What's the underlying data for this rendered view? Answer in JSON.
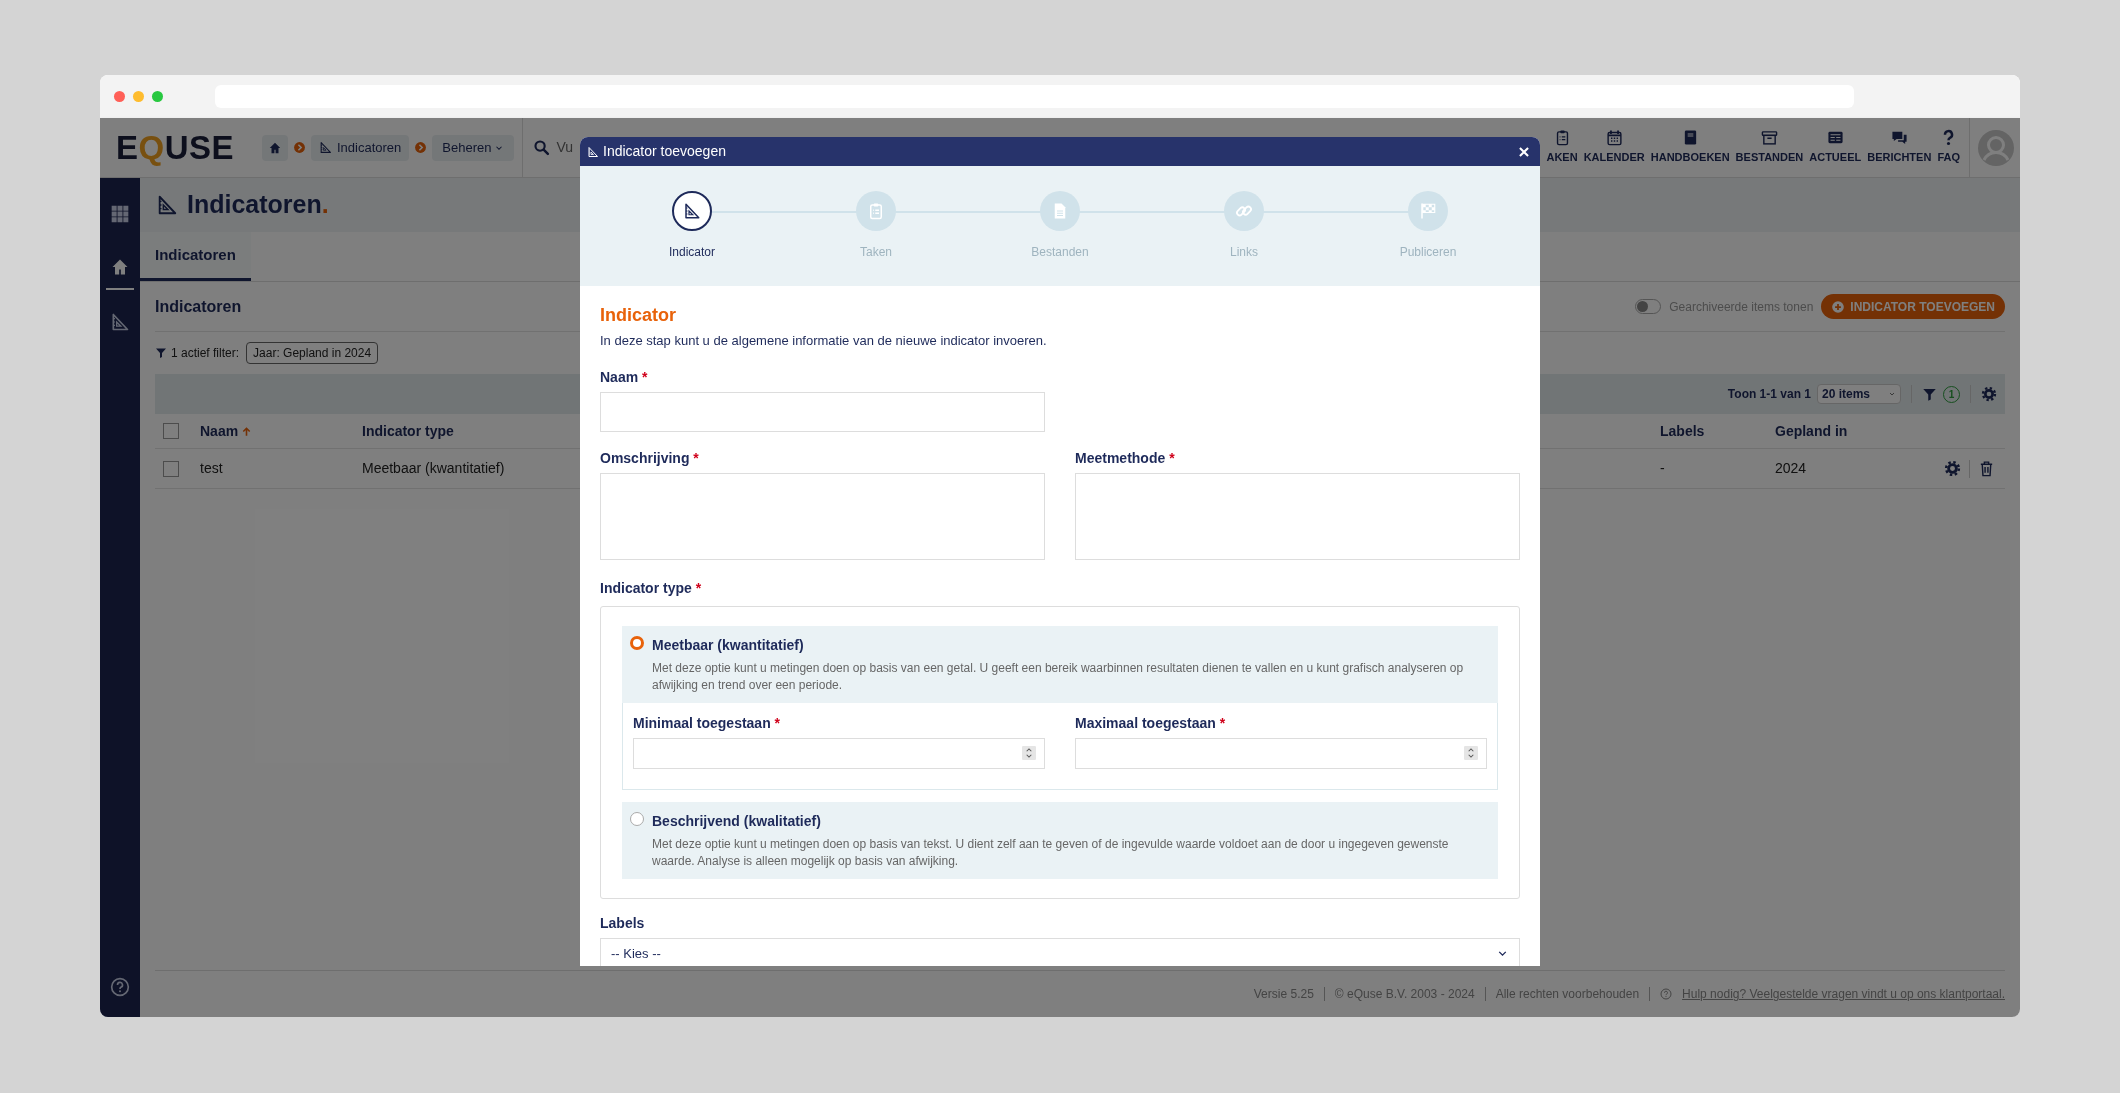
{
  "header": {
    "logo_parts": [
      {
        "text": "E",
        "accent": false
      },
      {
        "text": "Q",
        "accent": true
      },
      {
        "text": "USE",
        "accent": false
      }
    ],
    "breadcrumbs": [
      {
        "kind": "home"
      },
      {
        "kind": "page",
        "label": "Indicatoren"
      },
      {
        "kind": "menu",
        "label": "Beheren"
      }
    ],
    "search": {
      "placeholder": "Vu"
    },
    "nav": [
      {
        "label": "AKEN"
      },
      {
        "label": "KALENDER"
      },
      {
        "label": "HANDBOEKEN"
      },
      {
        "label": "BESTANDEN"
      },
      {
        "label": "ACTUEEL"
      },
      {
        "label": "BERICHTEN"
      },
      {
        "label": "FAQ"
      }
    ]
  },
  "sidebar": {
    "items": [
      {
        "selected": false
      },
      {
        "selected": true
      },
      {
        "selected": false
      }
    ]
  },
  "page": {
    "title": "Indicatoren",
    "title_mark": ".",
    "tabs": [
      {
        "label": "Indicatoren",
        "selected": true
      }
    ],
    "panel": {
      "heading": "Indicatoren",
      "archive_toggle": {
        "label": "Gearchiveerde items tonen",
        "on": false
      },
      "add_button": "INDICATOR TOEVOEGEN",
      "filter": {
        "label": "1 actief filter:",
        "chips": [
          "Jaar: Gepland in 2024"
        ]
      },
      "toolbar": {
        "range": "Toon 1-1 van 1",
        "page_size": "20 items",
        "filter_count": "1"
      },
      "table": {
        "all_checked": false,
        "columns": [
          {
            "label": "Naam",
            "sorted": true
          },
          {
            "label": "Indicator type",
            "sorted": false
          },
          {
            "label": "Labels",
            "sorted": false
          },
          {
            "label": "Gepland in",
            "sorted": false
          }
        ],
        "rows": [
          {
            "checked": false,
            "cells": [
              "test",
              "Meetbaar (kwantitatief)",
              "-",
              "2024"
            ]
          }
        ]
      }
    }
  },
  "footer": {
    "items": [
      "Versie 5.25",
      "© eQuse B.V. 2003 - 2024",
      "Alle rechten voorbehouden"
    ],
    "help_link": "Hulp nodig? Veelgestelde vragen vindt u op ons klantportaal."
  },
  "modal": {
    "title": "Indicator toevoegen",
    "steps": [
      {
        "label": "Indicator",
        "selected": true
      },
      {
        "label": "Taken",
        "selected": false
      },
      {
        "label": "Bestanden",
        "selected": false
      },
      {
        "label": "Links",
        "selected": false
      },
      {
        "label": "Publiceren",
        "selected": false
      }
    ],
    "section_title": "Indicator",
    "intro": "In deze stap kunt u de algemene informatie van de nieuwe indicator invoeren.",
    "name_field": {
      "label": "Naam",
      "required_mark": "*"
    },
    "text_fields": [
      {
        "label": "Omschrijving",
        "required_mark": "*"
      },
      {
        "label": "Meetmethode",
        "required_mark": "*"
      }
    ],
    "type_label": {
      "label": "Indicator type",
      "required_mark": "*"
    },
    "options": [
      {
        "title": "Meetbaar (kwantitatief)",
        "description": "Met deze optie kunt u metingen doen op basis van een getal. U geeft een bereik waarbinnen resultaten dienen te vallen en u kunt grafisch analyseren op afwijking en trend over een periode.",
        "selected": true,
        "fields": [
          {
            "label": "Minimaal toegestaan",
            "required_mark": "*"
          },
          {
            "label": "Maximaal toegestaan",
            "required_mark": "*"
          }
        ]
      },
      {
        "title": "Beschrijvend (kwalitatief)",
        "description": "Met deze optie kunt u metingen doen op basis van tekst. U dient zelf aan te geven of de ingevulde waarde voldoet aan de door u ingegeven gewenste waarde. Analyse is alleen mogelijk op basis van afwijking.",
        "selected": false
      }
    ],
    "labels_field": {
      "label": "Labels",
      "value": "-- Kies --"
    }
  }
}
